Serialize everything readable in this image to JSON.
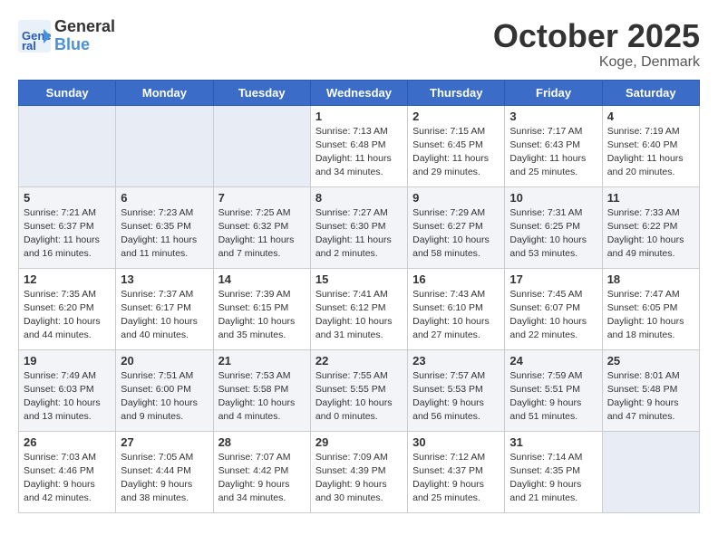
{
  "logo": {
    "line1": "General",
    "line2": "Blue"
  },
  "title": "October 2025",
  "subtitle": "Koge, Denmark",
  "weekdays": [
    "Sunday",
    "Monday",
    "Tuesday",
    "Wednesday",
    "Thursday",
    "Friday",
    "Saturday"
  ],
  "weeks": [
    [
      {
        "day": "",
        "info": ""
      },
      {
        "day": "",
        "info": ""
      },
      {
        "day": "",
        "info": ""
      },
      {
        "day": "1",
        "info": "Sunrise: 7:13 AM\nSunset: 6:48 PM\nDaylight: 11 hours\nand 34 minutes."
      },
      {
        "day": "2",
        "info": "Sunrise: 7:15 AM\nSunset: 6:45 PM\nDaylight: 11 hours\nand 29 minutes."
      },
      {
        "day": "3",
        "info": "Sunrise: 7:17 AM\nSunset: 6:43 PM\nDaylight: 11 hours\nand 25 minutes."
      },
      {
        "day": "4",
        "info": "Sunrise: 7:19 AM\nSunset: 6:40 PM\nDaylight: 11 hours\nand 20 minutes."
      }
    ],
    [
      {
        "day": "5",
        "info": "Sunrise: 7:21 AM\nSunset: 6:37 PM\nDaylight: 11 hours\nand 16 minutes."
      },
      {
        "day": "6",
        "info": "Sunrise: 7:23 AM\nSunset: 6:35 PM\nDaylight: 11 hours\nand 11 minutes."
      },
      {
        "day": "7",
        "info": "Sunrise: 7:25 AM\nSunset: 6:32 PM\nDaylight: 11 hours\nand 7 minutes."
      },
      {
        "day": "8",
        "info": "Sunrise: 7:27 AM\nSunset: 6:30 PM\nDaylight: 11 hours\nand 2 minutes."
      },
      {
        "day": "9",
        "info": "Sunrise: 7:29 AM\nSunset: 6:27 PM\nDaylight: 10 hours\nand 58 minutes."
      },
      {
        "day": "10",
        "info": "Sunrise: 7:31 AM\nSunset: 6:25 PM\nDaylight: 10 hours\nand 53 minutes."
      },
      {
        "day": "11",
        "info": "Sunrise: 7:33 AM\nSunset: 6:22 PM\nDaylight: 10 hours\nand 49 minutes."
      }
    ],
    [
      {
        "day": "12",
        "info": "Sunrise: 7:35 AM\nSunset: 6:20 PM\nDaylight: 10 hours\nand 44 minutes."
      },
      {
        "day": "13",
        "info": "Sunrise: 7:37 AM\nSunset: 6:17 PM\nDaylight: 10 hours\nand 40 minutes."
      },
      {
        "day": "14",
        "info": "Sunrise: 7:39 AM\nSunset: 6:15 PM\nDaylight: 10 hours\nand 35 minutes."
      },
      {
        "day": "15",
        "info": "Sunrise: 7:41 AM\nSunset: 6:12 PM\nDaylight: 10 hours\nand 31 minutes."
      },
      {
        "day": "16",
        "info": "Sunrise: 7:43 AM\nSunset: 6:10 PM\nDaylight: 10 hours\nand 27 minutes."
      },
      {
        "day": "17",
        "info": "Sunrise: 7:45 AM\nSunset: 6:07 PM\nDaylight: 10 hours\nand 22 minutes."
      },
      {
        "day": "18",
        "info": "Sunrise: 7:47 AM\nSunset: 6:05 PM\nDaylight: 10 hours\nand 18 minutes."
      }
    ],
    [
      {
        "day": "19",
        "info": "Sunrise: 7:49 AM\nSunset: 6:03 PM\nDaylight: 10 hours\nand 13 minutes."
      },
      {
        "day": "20",
        "info": "Sunrise: 7:51 AM\nSunset: 6:00 PM\nDaylight: 10 hours\nand 9 minutes."
      },
      {
        "day": "21",
        "info": "Sunrise: 7:53 AM\nSunset: 5:58 PM\nDaylight: 10 hours\nand 4 minutes."
      },
      {
        "day": "22",
        "info": "Sunrise: 7:55 AM\nSunset: 5:55 PM\nDaylight: 10 hours\nand 0 minutes."
      },
      {
        "day": "23",
        "info": "Sunrise: 7:57 AM\nSunset: 5:53 PM\nDaylight: 9 hours\nand 56 minutes."
      },
      {
        "day": "24",
        "info": "Sunrise: 7:59 AM\nSunset: 5:51 PM\nDaylight: 9 hours\nand 51 minutes."
      },
      {
        "day": "25",
        "info": "Sunrise: 8:01 AM\nSunset: 5:48 PM\nDaylight: 9 hours\nand 47 minutes."
      }
    ],
    [
      {
        "day": "26",
        "info": "Sunrise: 7:03 AM\nSunset: 4:46 PM\nDaylight: 9 hours\nand 42 minutes."
      },
      {
        "day": "27",
        "info": "Sunrise: 7:05 AM\nSunset: 4:44 PM\nDaylight: 9 hours\nand 38 minutes."
      },
      {
        "day": "28",
        "info": "Sunrise: 7:07 AM\nSunset: 4:42 PM\nDaylight: 9 hours\nand 34 minutes."
      },
      {
        "day": "29",
        "info": "Sunrise: 7:09 AM\nSunset: 4:39 PM\nDaylight: 9 hours\nand 30 minutes."
      },
      {
        "day": "30",
        "info": "Sunrise: 7:12 AM\nSunset: 4:37 PM\nDaylight: 9 hours\nand 25 minutes."
      },
      {
        "day": "31",
        "info": "Sunrise: 7:14 AM\nSunset: 4:35 PM\nDaylight: 9 hours\nand 21 minutes."
      },
      {
        "day": "",
        "info": ""
      }
    ]
  ]
}
